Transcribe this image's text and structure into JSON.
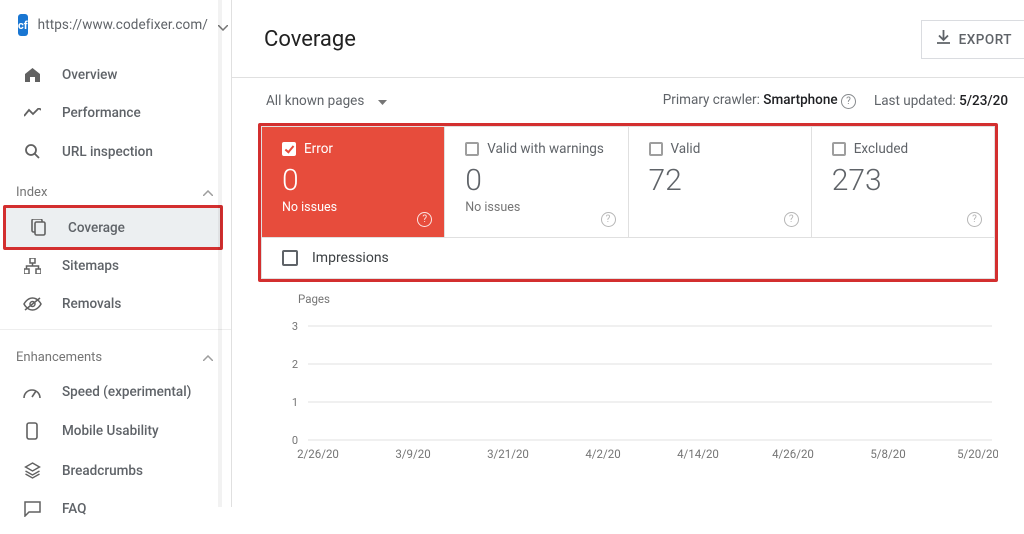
{
  "site": {
    "url": "https://www.codefixer.com/",
    "favicon_text": "cf"
  },
  "header": {
    "title": "Coverage",
    "export_label": "EXPORT"
  },
  "sidebar": {
    "sections": {
      "top": [
        {
          "icon": "home",
          "label": "Overview"
        },
        {
          "icon": "perf",
          "label": "Performance"
        },
        {
          "icon": "search",
          "label": "URL inspection"
        }
      ],
      "index_label": "Index",
      "index": [
        {
          "icon": "copy",
          "label": "Coverage",
          "active": true
        },
        {
          "icon": "sitemap",
          "label": "Sitemaps"
        },
        {
          "icon": "removal",
          "label": "Removals"
        }
      ],
      "enh_label": "Enhancements",
      "enh": [
        {
          "icon": "gauge",
          "label": "Speed (experimental)"
        },
        {
          "icon": "mobile",
          "label": "Mobile Usability"
        },
        {
          "icon": "bread",
          "label": "Breadcrumbs"
        },
        {
          "icon": "faq",
          "label": "FAQ"
        }
      ]
    }
  },
  "filter": {
    "mode": "All known pages",
    "crawler_label": "Primary crawler:",
    "crawler_value": "Smartphone",
    "updated_label": "Last updated:",
    "updated_value": "5/23/20"
  },
  "cards": {
    "error": {
      "label": "Error",
      "count": "0",
      "sub": "No issues",
      "active": true
    },
    "warn": {
      "label": "Valid with warnings",
      "count": "0",
      "sub": "No issues"
    },
    "valid": {
      "label": "Valid",
      "count": "72",
      "sub": ""
    },
    "excl": {
      "label": "Excluded",
      "count": "273",
      "sub": ""
    }
  },
  "impressions": {
    "label": "Impressions",
    "checked": false
  },
  "chart_data": {
    "type": "line",
    "title": "Pages",
    "ylabel": "Pages",
    "ylim": [
      0,
      3
    ],
    "yticks": [
      0,
      1,
      2,
      3
    ],
    "x": [
      "2/26/20",
      "3/9/20",
      "3/21/20",
      "4/2/20",
      "4/14/20",
      "4/26/20",
      "5/8/20",
      "5/20/20"
    ],
    "series": [
      {
        "name": "Error",
        "values": [
          0,
          0,
          0,
          0,
          0,
          0,
          0,
          0
        ]
      }
    ]
  }
}
